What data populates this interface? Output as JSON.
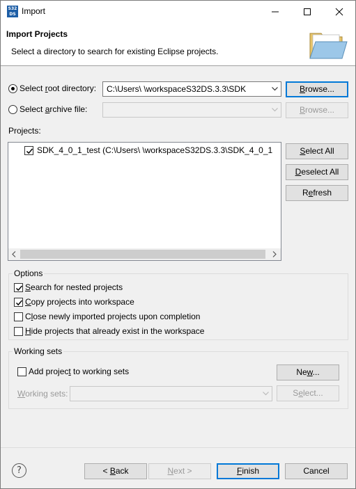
{
  "window": {
    "title": "Import",
    "app_icon_text_top": "S32",
    "app_icon_text_bottom": "DS"
  },
  "header": {
    "title": "Import Projects",
    "description": "Select a directory to search for existing Eclipse projects."
  },
  "source": {
    "root_dir_label_pre": "Select ",
    "root_dir_label_u": "r",
    "root_dir_label_post": "oot directory:",
    "root_dir_value": "C:\\Users\\             \\workspaceS32DS.3.3\\SDK",
    "archive_label_pre": "Select ",
    "archive_label_u": "a",
    "archive_label_post": "rchive file:",
    "archive_value": "",
    "browse_label_u": "B",
    "browse_label_post": "rowse..."
  },
  "projects": {
    "label": "Projects:",
    "items": [
      {
        "name": "SDK_4_0_1_test (C:\\Users\\             \\workspaceS32DS.3.3\\SDK_4_0_1",
        "checked": true
      }
    ],
    "select_all_u": "S",
    "select_all_post": "elect All",
    "deselect_all_u": "D",
    "deselect_all_post": "eselect All",
    "refresh_pre": "R",
    "refresh_u": "e",
    "refresh_post": "fresh"
  },
  "options": {
    "title": "Options",
    "items": [
      {
        "pre": "",
        "u": "S",
        "post": "earch for nested projects",
        "checked": true
      },
      {
        "pre": "",
        "u": "C",
        "post": "opy projects into workspace",
        "checked": true
      },
      {
        "pre": "C",
        "u": "l",
        "post": "ose newly imported projects upon completion",
        "checked": false
      },
      {
        "pre": "",
        "u": "H",
        "post": "ide projects that already exist in the workspace",
        "checked": false
      }
    ]
  },
  "working_sets": {
    "title": "Working sets",
    "add_pre": "Add projec",
    "add_u": "t",
    "add_post": " to working sets",
    "add_checked": false,
    "label_u": "W",
    "label_post": "orking sets:",
    "value": "",
    "new_pre": "Ne",
    "new_u": "w",
    "new_post": "...",
    "select_pre": "S",
    "select_u": "e",
    "select_post": "lect..."
  },
  "footer": {
    "help": "?",
    "back_pre": "< ",
    "back_u": "B",
    "back_post": "ack",
    "next_u": "N",
    "next_post": "ext >",
    "finish_u": "F",
    "finish_post": "inish",
    "cancel": "Cancel"
  },
  "colors": {
    "focus": "#0078d7",
    "button_bg": "#e1e1e1",
    "dialog_bg": "#f0f0f0",
    "disabled_text": "#9a9a9a"
  }
}
